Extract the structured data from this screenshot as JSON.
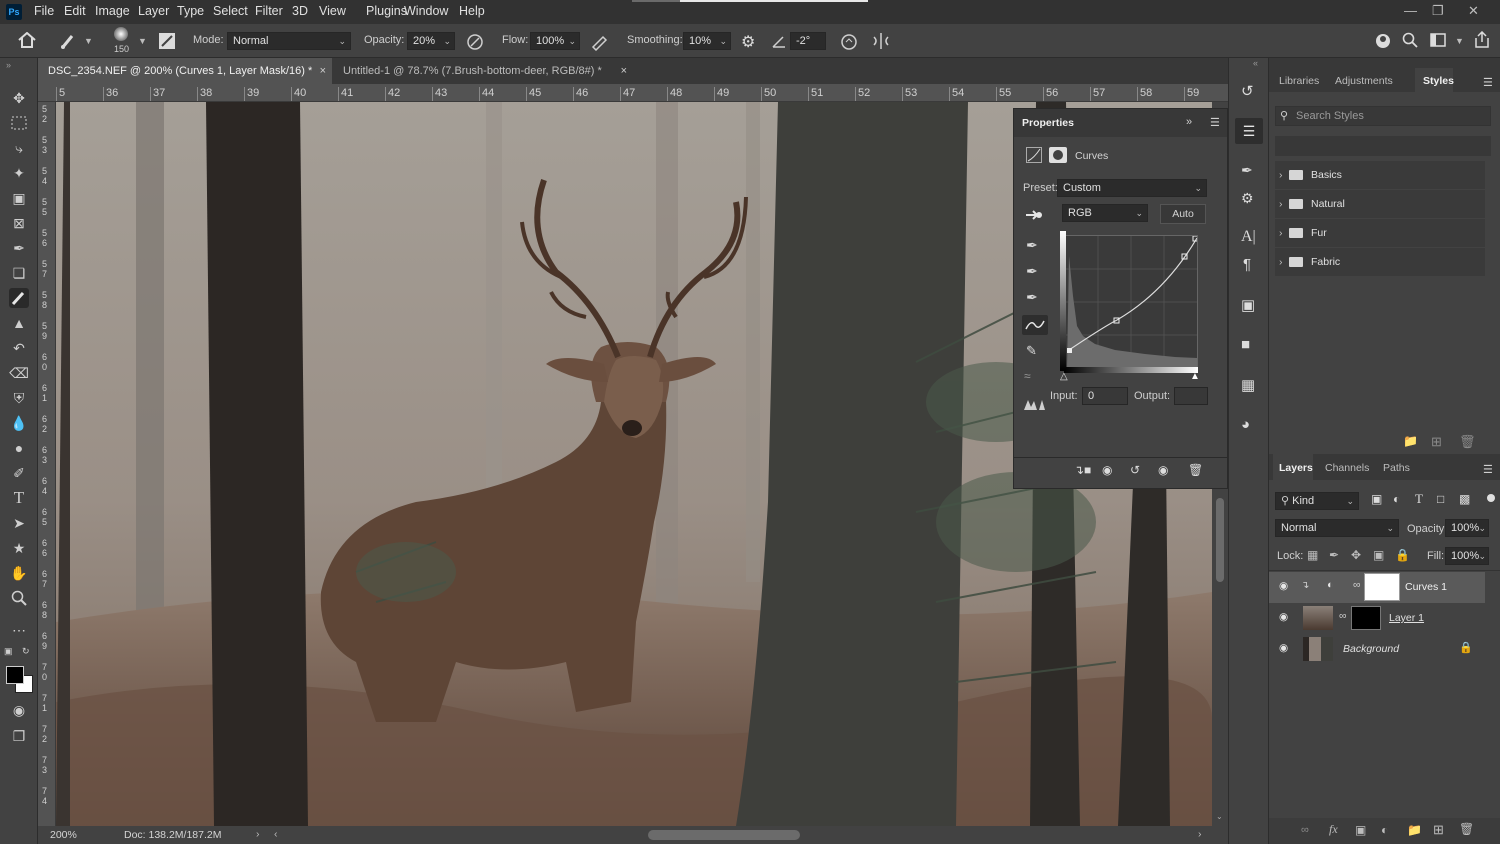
{
  "menu": {
    "logo": "Ps",
    "items": [
      "File",
      "Edit",
      "Image",
      "Layer",
      "Type",
      "Select",
      "Filter",
      "3D",
      "View",
      "Plugins",
      "Window",
      "Help"
    ]
  },
  "options": {
    "brush_size": "150",
    "mode_label": "Mode:",
    "mode_value": "Normal",
    "opacity_label": "Opacity:",
    "opacity_value": "20%",
    "flow_label": "Flow:",
    "flow_value": "100%",
    "smoothing_label": "Smoothing:",
    "smoothing_value": "10%",
    "angle_value": "-2°"
  },
  "tabs": [
    {
      "label": "DSC_2354.NEF @ 200% (Curves 1, Layer Mask/16) *",
      "active": true
    },
    {
      "label": "Untitled-1 @ 78.7% (7.Brush-bottom-deer, RGB/8#) *",
      "active": false
    }
  ],
  "ruler": {
    "top": [
      "5",
      "36",
      "37",
      "38",
      "39",
      "40",
      "41",
      "42",
      "43",
      "44",
      "45",
      "46",
      "47",
      "48",
      "49",
      "50",
      "51",
      "52",
      "53",
      "54",
      "55",
      "56",
      "57",
      "58",
      "59"
    ],
    "left": [
      "5\n2",
      "5\n3",
      "5\n4",
      "5\n5",
      "5\n6",
      "5\n7",
      "5\n8",
      "5\n9",
      "6\n0",
      "6\n1",
      "6\n2",
      "6\n3",
      "6\n4",
      "6\n5",
      "6\n6",
      "6\n7",
      "6\n8",
      "6\n9",
      "7\n0",
      "7\n1",
      "7\n2",
      "7\n3",
      "7\n4"
    ]
  },
  "status": {
    "zoom": "200%",
    "doc": "Doc: 138.2M/187.2M"
  },
  "properties": {
    "title": "Properties",
    "adjustment": "Curves",
    "preset_label": "Preset:",
    "preset_value": "Custom",
    "channel": "RGB",
    "auto": "Auto",
    "input_label": "Input:",
    "input_value": "0",
    "output_label": "Output:",
    "output_value": ""
  },
  "right_tabs": {
    "libraries": "Libraries",
    "adjustments": "Adjustments",
    "styles": "Styles"
  },
  "styles": {
    "search_placeholder": "Search Styles",
    "groups": [
      "Basics",
      "Natural",
      "Fur",
      "Fabric"
    ]
  },
  "layers_tabs": {
    "layers": "Layers",
    "channels": "Channels",
    "paths": "Paths"
  },
  "layers": {
    "kind": "Kind",
    "blend": "Normal",
    "opacity_label": "Opacity:",
    "opacity_value": "100%",
    "lock_label": "Lock:",
    "fill_label": "Fill:",
    "fill_value": "100%",
    "items": [
      {
        "name": "Curves 1",
        "selected": true
      },
      {
        "name": "Layer 1",
        "selected": false
      },
      {
        "name": "Background",
        "selected": false
      }
    ]
  },
  "colors": {
    "accent": "#31a8ff",
    "panel": "#424242",
    "dark": "#323232"
  }
}
